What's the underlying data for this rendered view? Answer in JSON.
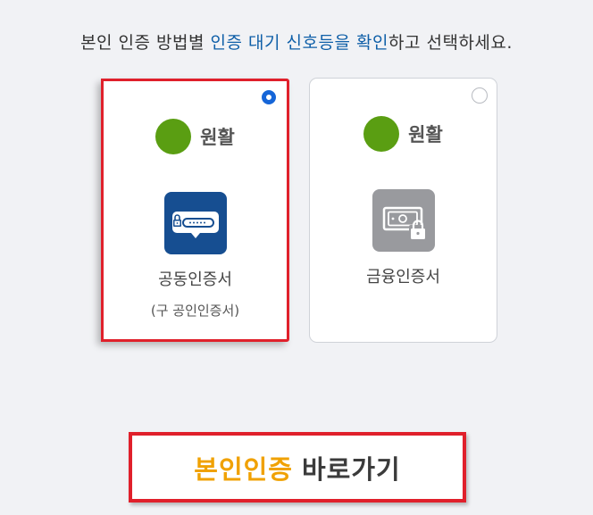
{
  "headline": {
    "part1": "본인 인증 방법별 ",
    "highlight1": "인증 대기 신호등을",
    "part2": " ",
    "highlight2": "확인",
    "part3": "하고 선택하세요."
  },
  "options": [
    {
      "status_label": "원활",
      "status_color": "#5a9e12",
      "icon": "certificate-chat-icon",
      "title": "공동인증서",
      "subtitle": "(구 공인인증서)",
      "selected": true
    },
    {
      "status_label": "원활",
      "status_color": "#5a9e12",
      "icon": "financial-certificate-lock-icon",
      "title": "금융인증서",
      "selected": false
    }
  ],
  "cta": {
    "accent_text": "본인인증",
    "rest_text": "바로가기",
    "accent_color": "#f0a100"
  }
}
